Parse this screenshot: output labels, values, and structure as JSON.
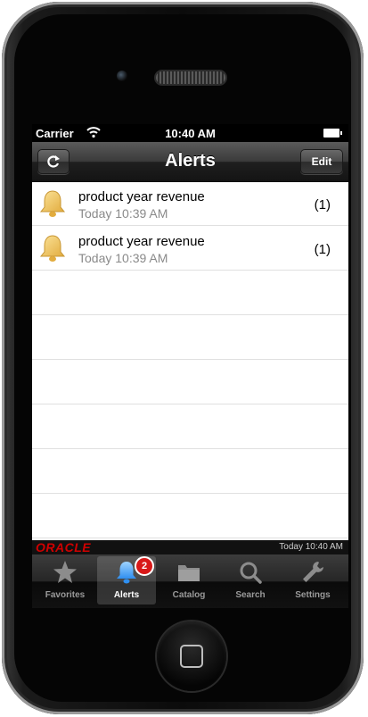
{
  "status_bar": {
    "carrier": "Carrier",
    "time": "10:40 AM"
  },
  "nav": {
    "title": "Alerts",
    "edit_label": "Edit"
  },
  "alerts": [
    {
      "title": "product year revenue",
      "time": "Today 10:39 AM",
      "count": "(1)"
    },
    {
      "title": "product year revenue",
      "time": "Today 10:39 AM",
      "count": "(1)"
    }
  ],
  "footer": {
    "brand": "ORACLE",
    "timestamp": "Today 10:40 AM"
  },
  "tabs": [
    {
      "label": "Favorites",
      "icon": "star-icon"
    },
    {
      "label": "Alerts",
      "icon": "bell-icon",
      "badge": "2",
      "active": true
    },
    {
      "label": "Catalog",
      "icon": "folder-icon"
    },
    {
      "label": "Search",
      "icon": "search-icon"
    },
    {
      "label": "Settings",
      "icon": "wrench-icon"
    }
  ],
  "colors": {
    "oracle_red": "#d00000",
    "badge_red": "#d81919",
    "bell_gold": "#f2c55a"
  }
}
